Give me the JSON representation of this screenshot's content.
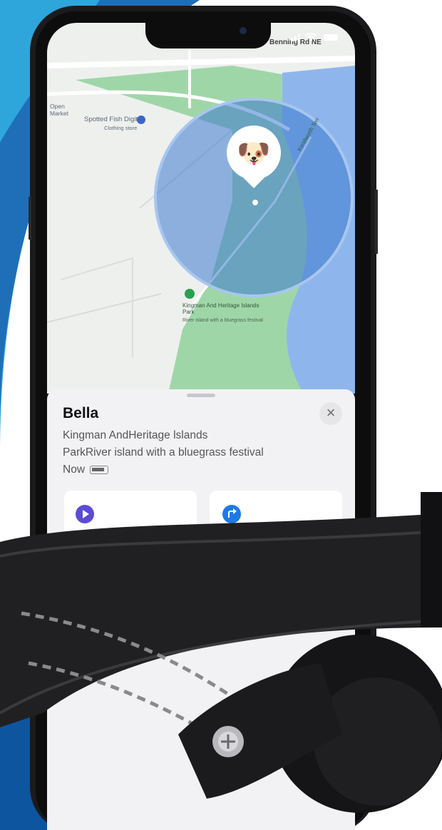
{
  "status_bar": {
    "signal_icon": "cellular-signal-icon",
    "wifi_icon": "wifi-icon",
    "battery_icon": "battery-icon"
  },
  "map": {
    "street_label": "Benning Rd NE",
    "poi_label": "Spotted Fish Digital",
    "poi_sublabel": "Clothing store",
    "market_label": "Open\nMarket",
    "road_label": "Kenilworth Terr",
    "park_label": "Kingman And Heritage Islands Park",
    "park_sublabel": "River island with a bluegrass festival",
    "pet_emoji": "🐶",
    "accuracy_circle_color": "#5b8fd6"
  },
  "sheet": {
    "title": "Bella",
    "line1": "Kingman AndHeritage lslands",
    "line2": "ParkRiver island with a bluegrass festival",
    "status": "Now",
    "close_glyph": "×",
    "play_icon": "play-icon",
    "directions_icon": "directions-icon",
    "play_color": "#5b4bd6",
    "directions_color": "#1f7ae6"
  },
  "colors": {
    "brand_blue": "#1f6fb8",
    "light_blue": "#2ea6dc"
  }
}
